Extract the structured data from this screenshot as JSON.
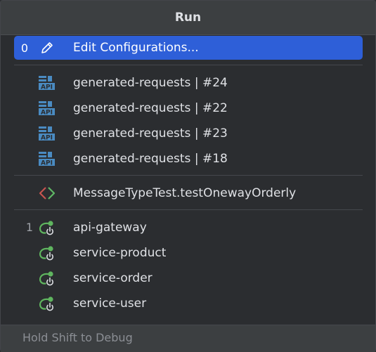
{
  "header": {
    "title": "Run"
  },
  "edit_config": {
    "number": "0",
    "label": "Edit Configurations...",
    "icon": "pencil-icon"
  },
  "http_requests": [
    {
      "label": "generated-requests | #24",
      "icon": "api-icon"
    },
    {
      "label": "generated-requests | #22",
      "icon": "api-icon"
    },
    {
      "label": "generated-requests | #23",
      "icon": "api-icon"
    },
    {
      "label": "generated-requests | #18",
      "icon": "api-icon"
    }
  ],
  "tests": [
    {
      "label": "MessageTypeTest.testOnewayOrderly",
      "icon": "test-icon"
    }
  ],
  "services": [
    {
      "number": "1",
      "label": "api-gateway",
      "icon": "spring-boot-icon"
    },
    {
      "number": "",
      "label": "service-product",
      "icon": "spring-boot-icon"
    },
    {
      "number": "",
      "label": "service-order",
      "icon": "spring-boot-icon"
    },
    {
      "number": "",
      "label": "service-user",
      "icon": "spring-boot-icon"
    }
  ],
  "footer": {
    "hint": "Hold Shift to Debug"
  },
  "colors": {
    "accent": "#2e5fd8",
    "api_icon": "#4a8bc2",
    "spring_green": "#5fb55f",
    "test_red": "#c75450",
    "test_green": "#5fb865"
  }
}
